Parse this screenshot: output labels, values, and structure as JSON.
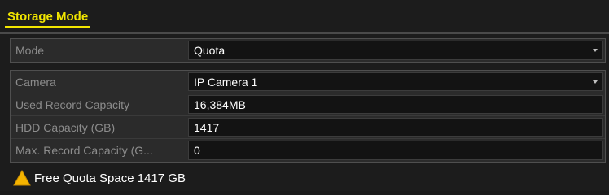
{
  "header": {
    "title": "Storage Mode"
  },
  "mode": {
    "label": "Mode",
    "value": "Quota"
  },
  "fields": [
    {
      "label": "Camera",
      "value": "IP Camera 1"
    },
    {
      "label": "Used Record Capacity",
      "value": "16,384MB"
    },
    {
      "label": "HDD Capacity (GB)",
      "value": "1417"
    },
    {
      "label": "Max. Record Capacity (G...",
      "value": "0"
    }
  ],
  "footer": {
    "message": "Free Quota Space 1417 GB",
    "icon": "warning-icon"
  },
  "colors": {
    "accent": "#f2e600",
    "warning": "#f5b400"
  }
}
